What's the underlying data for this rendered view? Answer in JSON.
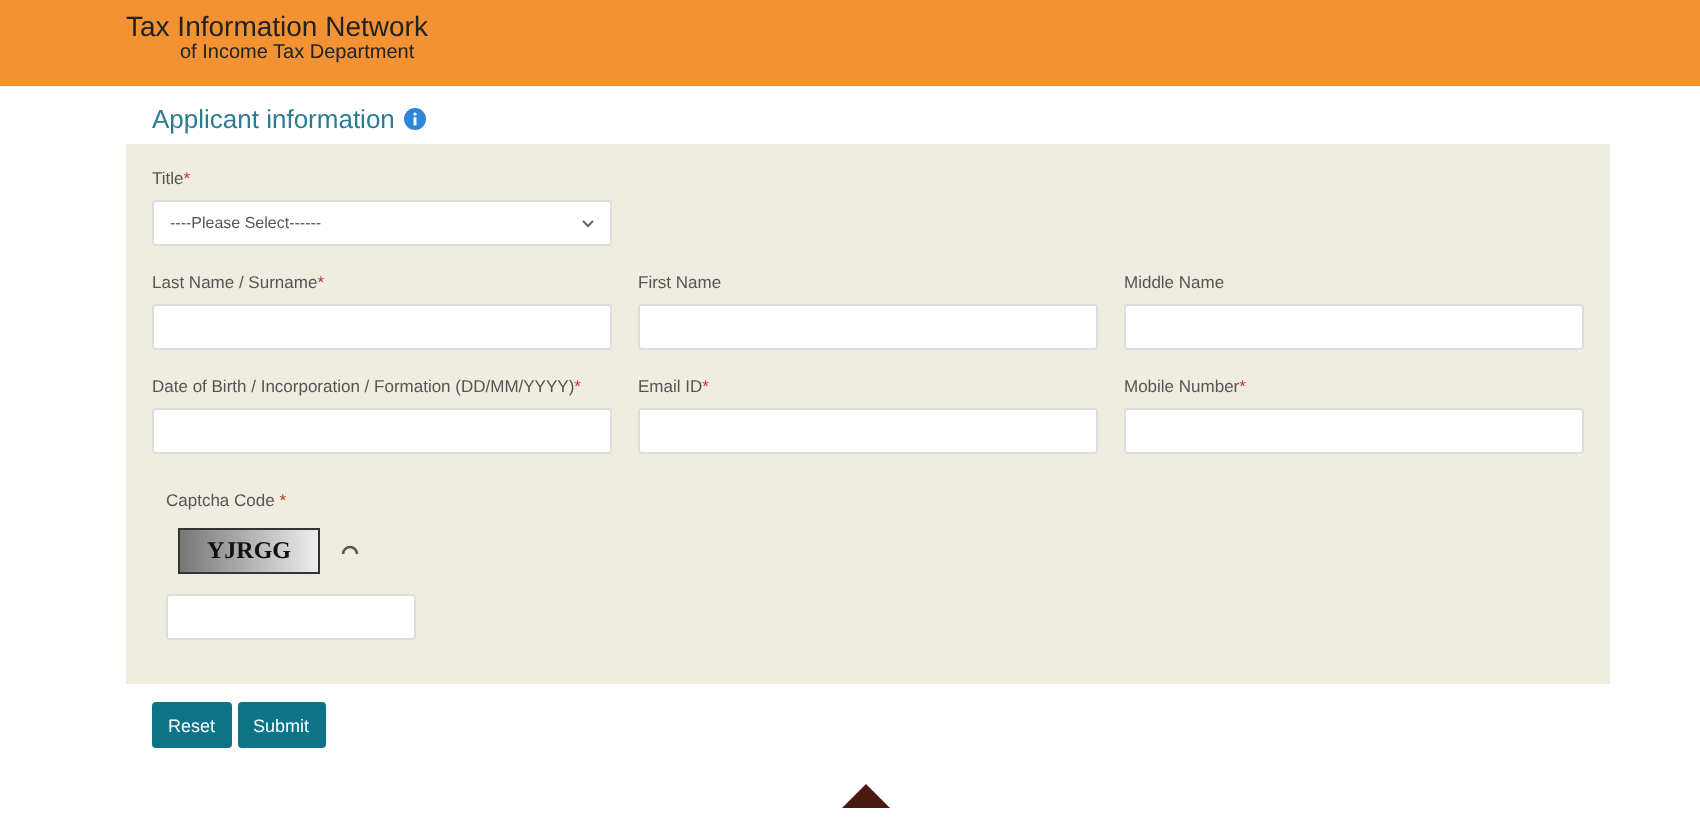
{
  "header": {
    "title": "Tax Information Network",
    "subtitle": "of Income Tax Department"
  },
  "section": {
    "title": "Applicant information"
  },
  "title_field": {
    "label": "Title",
    "mark": "*",
    "value": "----Please Select------"
  },
  "rows": [
    [
      {
        "label": "Last Name / Surname",
        "mark": "*"
      },
      {
        "label": "First Name"
      },
      {
        "label": "Middle Name"
      }
    ],
    [
      {
        "label": "Date of Birth / Incorporation / Formation (DD/MM/YYYY)",
        "mark": "*"
      },
      {
        "label": "Email ID",
        "mark": "*"
      },
      {
        "label": "Mobile Number",
        "mark": "*"
      }
    ]
  ],
  "captcha": {
    "label": "Captcha Code",
    "mark": "*",
    "code": "YJRGG"
  },
  "buttons": [
    "Reset",
    "Submit"
  ]
}
